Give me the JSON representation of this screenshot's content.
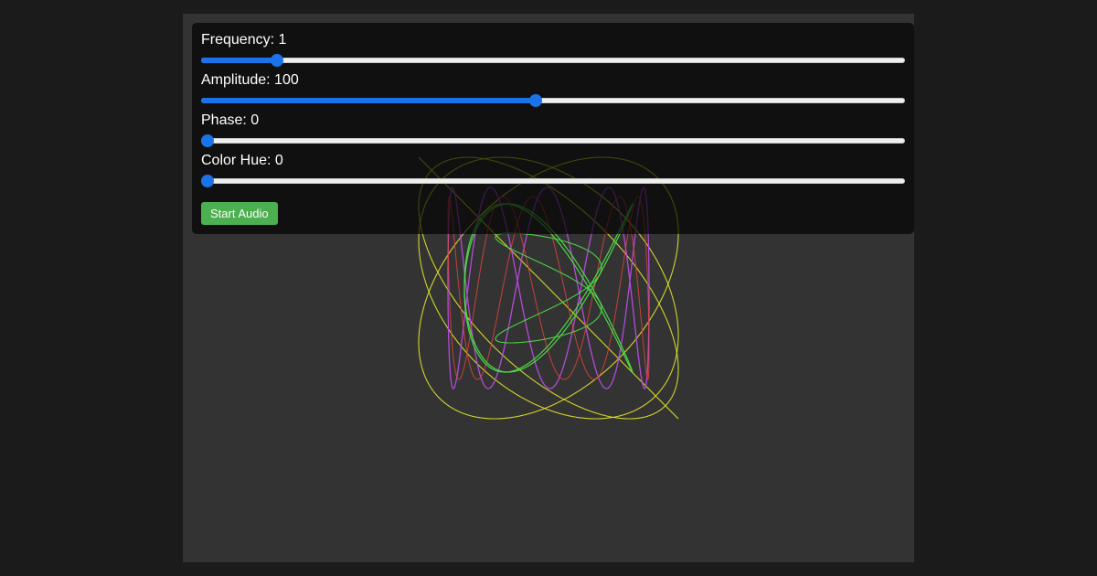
{
  "controls": {
    "frequency": {
      "label": "Frequency: 1",
      "fraction": 0.1
    },
    "amplitude": {
      "label": "Amplitude: 100",
      "fraction": 0.475
    },
    "phase": {
      "label": "Phase: 0",
      "fraction": 0.0
    },
    "hue": {
      "label": "Color Hue: 0",
      "fraction": 0.0
    },
    "start_button": "Start Audio"
  },
  "colors": {
    "page_background": "#1b1b1b",
    "stage_background": "#333333",
    "slider_accent": "#1a73e8",
    "button": "#4caf50",
    "curve_yellow": "#e4e42c",
    "curve_purple": "#b84ee0",
    "curve_red": "#e0443a",
    "curve_green": "#4ee046"
  }
}
